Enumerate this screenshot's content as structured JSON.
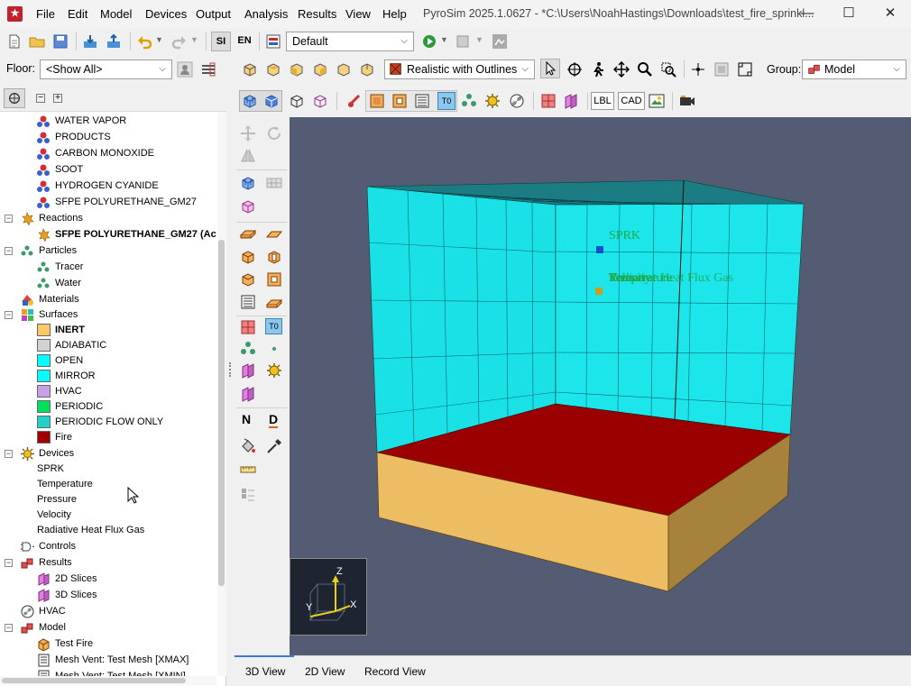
{
  "app": {
    "logo": "★",
    "title": "PyroSim 2025.1.0627 - *C:\\Users\\NoahHastings\\Downloads\\test_fire_sprinkl...",
    "menus": [
      "File",
      "Edit",
      "Model",
      "Devices",
      "Output",
      "Analysis",
      "Results",
      "View",
      "Help"
    ],
    "window_controls": [
      "—",
      "☐",
      "✕"
    ]
  },
  "toolbar1": {
    "units_si": "SI",
    "units_en": "EN",
    "scenario_value": "Default"
  },
  "toolbar2": {
    "floor_label": "Floor:",
    "floor_value": "<Show All>",
    "render_mode": "Realistic with Outlines",
    "group_label": "Group:",
    "group_value": "Model"
  },
  "viewtoolbar": {
    "lbl": "LBL",
    "cad": "CAD"
  },
  "sidebar_tools": {
    "n": "N",
    "d": "D",
    "t0": "T0"
  },
  "tree": {
    "species": [
      "WATER VAPOR",
      "PRODUCTS",
      "CARBON MONOXIDE",
      "SOOT",
      "HYDROGEN CYANIDE",
      "SFPE POLYURETHANE_GM27"
    ],
    "reactions": "Reactions",
    "reaction_item": "SFPE POLYURETHANE_GM27 (Acti",
    "particles": "Particles",
    "particle_items": [
      "Tracer",
      "Water"
    ],
    "materials": "Materials",
    "surfaces": "Surfaces",
    "surface_items": [
      {
        "label": "INERT",
        "color": "#ffc864",
        "bold": true
      },
      {
        "label": "ADIABATIC",
        "color": "#d2d2d2",
        "bold": false
      },
      {
        "label": "OPEN",
        "color": "#00ffff",
        "bold": false
      },
      {
        "label": "MIRROR",
        "color": "#00ffff",
        "bold": false
      },
      {
        "label": "HVAC",
        "color": "#c8a0e6",
        "bold": false
      },
      {
        "label": "PERIODIC",
        "color": "#00e05a",
        "bold": false
      },
      {
        "label": "PERIODIC FLOW ONLY",
        "color": "#20d2c8",
        "bold": false
      },
      {
        "label": "Fire",
        "color": "#a00000",
        "bold": false
      }
    ],
    "devices": "Devices",
    "device_items": [
      "SPRK",
      "Temperature",
      "Pressure",
      "Velocity",
      "Radiative Heat Flux Gas"
    ],
    "controls": "Controls",
    "results": "Results",
    "result_items": [
      "2D Slices",
      "3D Slices"
    ],
    "hvac": "HVAC",
    "model": "Model",
    "model_items": [
      "Test Fire",
      "Mesh Vent: Test Mesh [XMAX]",
      "Mesh Vent: Test Mesh [XMIN]"
    ],
    "collapse": "−",
    "expand": "+"
  },
  "viewport": {
    "sprk_label": "SPRK",
    "overlap_labels": [
      "Temperature",
      "Pressure",
      "Velocity",
      "Radiative Heat Flux Gas"
    ],
    "axis_z": "Z",
    "axis_y": "Y",
    "axis_x": "X",
    "colors": {
      "background": "#535c73",
      "walls": "#00ffff",
      "floor": "#8b0000",
      "base": "#e8b760",
      "sprk": "#1050d0",
      "device": "#c8a020",
      "label": "#1fa84a"
    }
  },
  "bottom_tabs": [
    "3D View",
    "2D View",
    "Record View"
  ]
}
